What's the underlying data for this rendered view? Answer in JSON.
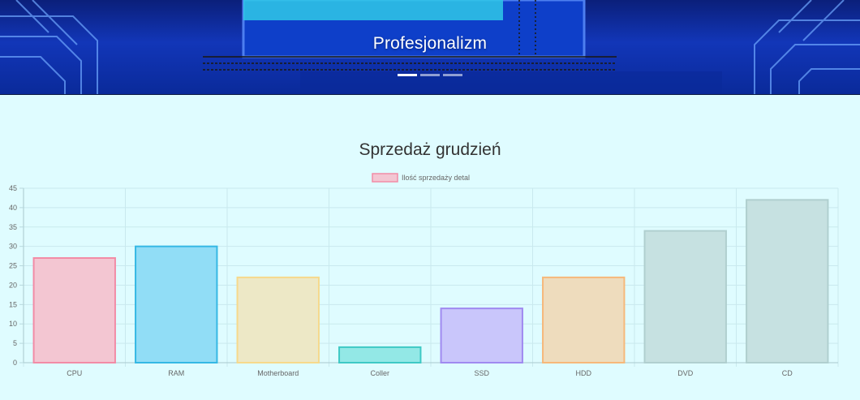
{
  "hero": {
    "caption": "Profesjonalizm",
    "slides": [
      {
        "active": true
      },
      {
        "active": false
      },
      {
        "active": false
      }
    ]
  },
  "section": {
    "title": "Sprzedaż grudzień"
  },
  "chart_data": {
    "type": "bar",
    "categories": [
      "CPU",
      "RAM",
      "Motherboard",
      "Coller",
      "SSD",
      "HDD",
      "DVD",
      "CD"
    ],
    "series": [
      {
        "name": "Ilość sprzedaży detal",
        "values": [
          27,
          30,
          22,
          4,
          14,
          22,
          34,
          42
        ]
      }
    ],
    "fill_colors": [
      "#f3c6d2",
      "#91ddf6",
      "#ede8c6",
      "#93e8e6",
      "#c9c6fb",
      "#eedcbd",
      "#c6e1e1",
      "#c6e1e1"
    ],
    "border_colors": [
      "#f28ca6",
      "#35b8e4",
      "#f6d98c",
      "#3ec9c5",
      "#a08af0",
      "#f6b87a",
      "#b0cfcf",
      "#b0cfcf"
    ],
    "legend_color": "#f3c6d2",
    "legend_border": "#f28ca6",
    "ylim": [
      0,
      45
    ],
    "yticks": [
      "0",
      "5",
      "10",
      "15",
      "20",
      "25",
      "30",
      "35",
      "40",
      "45"
    ],
    "grid": true,
    "legend_position": "top"
  }
}
